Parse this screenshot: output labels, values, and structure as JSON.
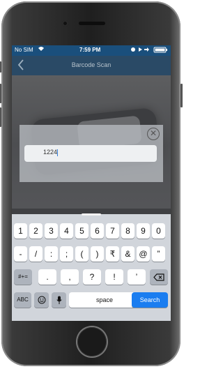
{
  "status_bar": {
    "carrier": "No SIM",
    "time": "7:59 PM"
  },
  "nav": {
    "back_icon": "chevron-left-icon",
    "title": "Barcode Scan"
  },
  "dialog": {
    "input_value": "1224"
  },
  "keyboard": {
    "row1": [
      "1",
      "2",
      "3",
      "4",
      "5",
      "6",
      "7",
      "8",
      "9",
      "0"
    ],
    "row2": [
      "-",
      "/",
      ":",
      ";",
      "(",
      ")",
      "₹",
      "&",
      "@",
      "”"
    ],
    "row3_left": "#+=",
    "row3": [
      ".",
      ",",
      "?",
      "!",
      "’"
    ],
    "abc": "ABC",
    "space": "space",
    "search": "Search"
  },
  "colors": {
    "status_bg": "#1a4f7c",
    "nav_bg": "#2a4a66",
    "search_key": "#1a7df0"
  }
}
